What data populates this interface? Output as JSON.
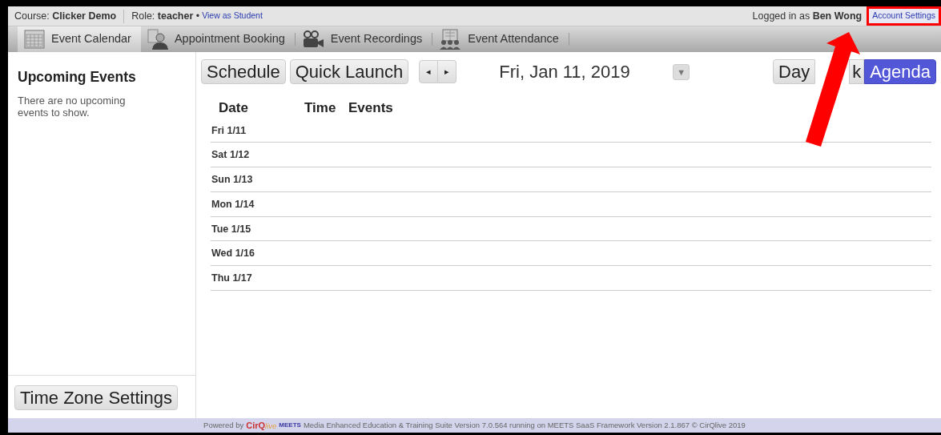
{
  "header": {
    "course_label": "Course:",
    "course": "Clicker Demo",
    "role_label": "Role:",
    "role": "teacher",
    "separator": "•",
    "view_as": "View as Student",
    "logged_in_label": "Logged in as",
    "user": "Ben Wong",
    "account_settings": "Account Settings",
    "account_settings_highlighted": true
  },
  "tabs": [
    {
      "label": "Event Calendar",
      "kind": "calendar",
      "selected": true
    },
    {
      "label": "Appointment Booking",
      "kind": "person",
      "selected": false
    },
    {
      "label": "Event Recordings",
      "kind": "camera",
      "selected": false
    },
    {
      "label": "Event Attendance",
      "kind": "group",
      "selected": false
    }
  ],
  "sidebar": {
    "title": "Upcoming Events",
    "message": "There are no upcoming events to show.",
    "button": "Time Zone Settings"
  },
  "toolbar": {
    "buttons": [
      "Schedule",
      "Quick Launch"
    ],
    "prev": "◂",
    "next": "▸",
    "date": "Fri, Jan 11, 2019",
    "dropdown": "▼",
    "views": [
      {
        "label": "Day",
        "selected": false
      },
      {
        "label": "k",
        "selected": false
      },
      {
        "label": "Agenda",
        "selected": true
      }
    ]
  },
  "agenda": {
    "columns": [
      "Date",
      "Time",
      "Events"
    ],
    "rows": [
      {
        "date": "Fri 1/11"
      },
      {
        "date": "Sat 1/12"
      },
      {
        "date": "Sun 1/13"
      },
      {
        "date": "Mon 1/14"
      },
      {
        "date": "Tue 1/15"
      },
      {
        "date": "Wed 1/16"
      },
      {
        "date": "Thu 1/17"
      }
    ]
  },
  "footer": {
    "powered_by": "Powered by",
    "logo_main": "CirQ",
    "logo_live": "live",
    "logo_product": "MEETS",
    "text": "Media Enhanced Education & Training Suite Version 7.0.564 running on MEETS SaaS Framework Version 2.1.867 © CirQlive 2019"
  }
}
